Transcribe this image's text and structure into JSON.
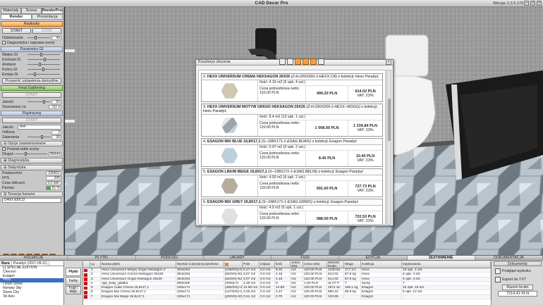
{
  "window": {
    "title": "CAD Decor Pro",
    "version": "Wersja: 2.3.5.179"
  },
  "left": {
    "tabs": [
      "Materiały",
      "Scena",
      "RenderPro"
    ],
    "subtabs": [
      "Render",
      "Prezentacja"
    ],
    "radiosity": {
      "title": "Radiosity",
      "start": "START",
      "stop": "STOP",
      "refresh_label": "Odświeżanie",
      "refresh_value": "4s",
      "diag_label": "Diagnostyka i naprawa sceny"
    },
    "gi": {
      "title": "Parametry GI",
      "rows": [
        "Wpływ GI",
        "Kontrast GI",
        "Ambient",
        "Kolory GI",
        "Emisja GI"
      ],
      "restore": "Przywróć ustawienia domyślne"
    },
    "fg": {
      "title": "Final Gathering",
      "start": "START",
      "quality_label": "Jakość",
      "quality_value": "92",
      "time_label": "Szacowany czas",
      "time_value": "111 s"
    },
    "rt": {
      "title": "Raytracing",
      "start": "START",
      "quality_label": "Jakość",
      "quality_value": "4x4",
      "refl_label": "Odbicia",
      "refl_value": "2",
      "refr_label": "Załamania",
      "refr_value": "20"
    },
    "adv": {
      "title": "Opcje zaawansowane",
      "grid_label": "Podział siatki sceny",
      "length_label": "Długość",
      "length_value": "80mm"
    },
    "diag": {
      "title": "Diagnostyka"
    },
    "stats": {
      "title": "Statystyka",
      "rows": [
        {
          "k": "Powierzchni",
          "v": "230551"
        },
        {
          "k": "FPS",
          "v": "206"
        },
        {
          "k": "Czas obliczeń",
          "v": "0,0 sek."
        },
        {
          "k": "Pamięć",
          "v": "31 %"
        }
      ]
    },
    "tone": {
      "title": "Tonacja barwne",
      "value": "D400-200CD"
    }
  },
  "dialog": {
    "title": "Kosztorys zlecenia",
    "items": [
      {
        "num": "2.",
        "name": "HEXX UNIVERSUM CREMA HEKSAGON 26X26",
        "code": "(Z-H-260X260-1-HEXX.CR)",
        "coll": "z kolekcji: Hexx Paradyż",
        "qty": "Ilość: 4.16 m2 (6 opk. 4 szt.)",
        "unit_label": "Cena jednostkowa netto:",
        "unit": "120.00 PLN",
        "net": "499.20 PLN",
        "gross": "614.02 PLN",
        "vat": "VAT: 23%",
        "color": "#cfc6b3"
      },
      {
        "num": "3.",
        "name": "HEXX UNIVERSUM MOTYW GRIGIO HEKSAGON 26X26",
        "code": "(Z-H-260X260-1-HEXX--MOGG)",
        "coll": "z kolekcji: Hexx Paradyż",
        "qty": "Ilość: 8.4 m2 (13 opk. 1 szt.)",
        "unit_label": "Cena jednostkowa netto:",
        "unit": "120.00 PLN",
        "net": "1 008.00 PLN",
        "gross": "1 239.84 PLN",
        "vat": "VAT: 23%",
        "color": "#b9c4cc"
      },
      {
        "num": "4.",
        "name": "ESAGON MIX BLUE 19,8X17,1",
        "code": "(S--198X171-1-ESAG.BLMIX)",
        "coll": "z kolekcji: Esagon Paradyż",
        "qty": "Ilość: 0.07 m2 (0 opk. 2 szt.)",
        "unit_label": "Cena jednostkowa netto:",
        "unit": "120.00 PLN",
        "net": "8.40 PLN",
        "gross": "10.40 PLN",
        "vat": "VAT: 23%",
        "color": "#bcd0dc"
      },
      {
        "num": "5.",
        "name": "ESAGON LINUM BEIGE 19,8X17,1",
        "code": "(S--198X171-1-ESAG.BELIN)",
        "coll": "z kolekcji: Esagon Paradyż",
        "qty": "Ilość: 4.93 m2 (6 opk. 2 szt.)",
        "unit_label": "Cena jednostkowa netto:",
        "unit": "120.00 PLN",
        "net": "591.60 PLN",
        "gross": "727.73 PLN",
        "vat": "VAT: 23%",
        "color": "#b6ad9c"
      },
      {
        "num": "6.",
        "name": "ESAGON MIX GREY 19,8X17,1",
        "code": "(S--198X171-1-ESAG.GRMIX)",
        "coll": "z kolekcji: Esagon Paradyż",
        "qty": "Ilość: 4.9 m2 (6 opk. 1 szt.)",
        "unit_label": "Cena jednostkowa netto:",
        "unit": "120.00 PLN",
        "net": "588.00 PLN",
        "gross": "722.53 PLN",
        "vat": "VAT: 23%",
        "color": "#e0e0e0"
      }
    ]
  },
  "bottom": {
    "cat_tabs": [
      "KOLEKCJE",
      "PŁYTKI",
      "PODŁOGI",
      "UKŁADY",
      "FUGI",
      "EDYCJA",
      "ZESTAWIENIE",
      "DOKUMENTACJA"
    ],
    "collections": {
      "sub": [
        "Baza",
        "Paradyż (2017-09-11)"
      ],
      "items": [
        "[-] SPECIAL EDITION",
        "Chevron",
        "Esagon",
        "Hexx",
        "Linum Stone",
        "Norway Sky",
        "Stone City",
        "Tel Aviv"
      ]
    },
    "side_buttons": [
      "Płytki",
      "Farby",
      "Fugi i kleje"
    ],
    "table": {
      "headers": [
        "Lp",
        "Nazwa płytki",
        "Wymiar (cale)/przycięte/lewa",
        "",
        "Pole",
        "Odpad",
        "Ilość",
        "Jedno stka",
        "Cena netto",
        "Wartość brutto",
        "Waga",
        "Kolekcja",
        "Opakowania"
      ],
      "rows": [
        [
          "1",
          "Hexx Universum Motyw Grigio heksagon 2",
          "304x264",
          "[105/0/0]+0",
          "6.17 m2",
          "0.0 m2",
          "8.40",
          "m2",
          "120.00 PLN",
          "1239.84",
          "177.3 k",
          "Hexx",
          "13 opk. 1 szt."
        ],
        [
          "2",
          "Hexx Universum Crema heksagon 26x26",
          "304x264",
          "[52/0/0]+52",
          "3.07 m2",
          "0.0 m2",
          "4.16",
          "m2",
          "120.00 PLN",
          "614.02",
          "87.8 kg",
          "Hexx",
          "6 opk. 4 szt."
        ],
        [
          "3",
          "Hexx Universum Grigio heksagon 26x26",
          "304x264",
          "[52/0/0]+52",
          "3.07 m2",
          "0.0 m2",
          "4.16",
          "m2",
          "120.00 PLN",
          "614.02",
          "87.8 kg",
          "Hexx",
          "6 opk. 4 szt."
        ],
        [
          "4",
          "opp_biały_gladka",
          "600x300",
          "[0/9/0]+9",
          "1.29 m2",
          "0.0 m2",
          "9",
          "szt.",
          "1.00 PLN",
          "11.07 P",
          "7",
          "bump",
          "7"
        ],
        [
          "5",
          "Esagon Cube Crema 19,8x17,1",
          "225x171",
          "[360/0/0]+36",
          "12.68 m2",
          "0.0 m2",
          "12.68",
          "m2",
          "120.00 PLN",
          "1871.31",
          "158.1 kg",
          "Esagon",
          "15 opk. 15 szt."
        ],
        [
          "6",
          "Esagon Mix Crema 19,8x17,1",
          "225x171",
          "[127/0/0]+12",
          "3.26 m2",
          "0.0 m2",
          "4.47",
          "m2",
          "120.00 PLN",
          "660.16",
          "55.9 kg",
          "Esagon",
          "5 opk. 12 szt."
        ],
        [
          "7",
          "Esagon Mix Beige 19,8x17,1",
          "225x171",
          "[20/0/0]+20",
          "0.51 m2",
          "0.0 m2",
          "0.70",
          "m2",
          "120.00 PLN",
          "103.96",
          "",
          "Esagon",
          ""
        ]
      ]
    },
    "right": {
      "title": "Dokumenty",
      "print": "Podgląd wydruku",
      "export": "Export do TXT",
      "total_label": "Razem brutto",
      "total": "7214.41 PLN"
    }
  }
}
